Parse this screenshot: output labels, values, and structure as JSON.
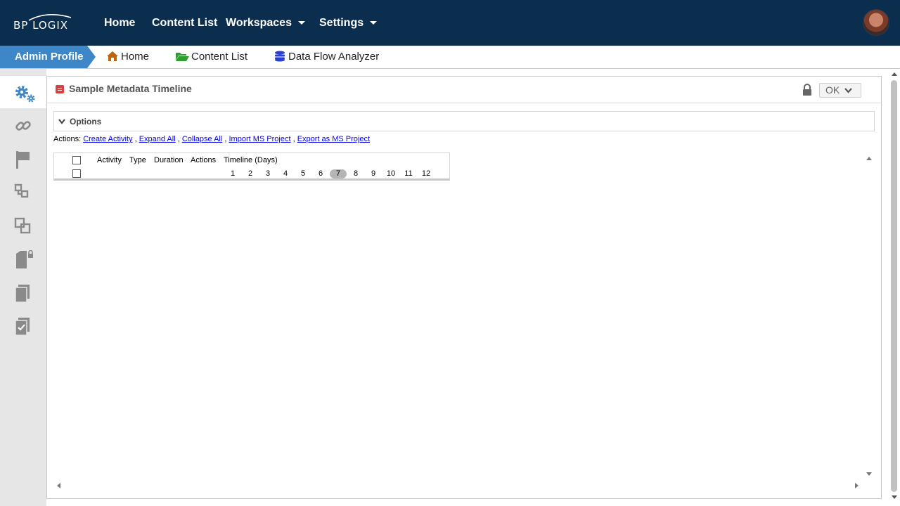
{
  "brand": {
    "logo_text": "BP LOGIX"
  },
  "topnav": {
    "items": [
      {
        "label": "Home",
        "has_dropdown": false
      },
      {
        "label": "Content List",
        "has_dropdown": false
      },
      {
        "label": "Workspaces",
        "has_dropdown": true
      },
      {
        "label": "Settings",
        "has_dropdown": true
      }
    ]
  },
  "breadcrumb": {
    "profile": "Admin Profile",
    "items": [
      {
        "label": "Home",
        "icon": "home-icon",
        "color": "#c0640a"
      },
      {
        "label": "Content List",
        "icon": "folder-open-icon",
        "color": "#2e9e2e"
      },
      {
        "label": "Data Flow Analyzer",
        "icon": "database-icon",
        "color": "#2a3ed0"
      }
    ]
  },
  "sidebar": {
    "items": [
      {
        "icon": "gears-icon",
        "active": true
      },
      {
        "icon": "link-icon",
        "active": false
      },
      {
        "icon": "flag-icon",
        "active": false
      },
      {
        "icon": "workflow-icon",
        "active": false
      },
      {
        "icon": "copy-squares-icon",
        "active": false
      },
      {
        "icon": "locked-document-icon",
        "active": false
      },
      {
        "icon": "documents-icon",
        "active": false
      },
      {
        "icon": "checked-document-icon",
        "active": false
      }
    ]
  },
  "panel": {
    "title": "Sample Metadata Timeline",
    "ok_label": "OK",
    "options_label": "Options",
    "actions_prefix": "Actions:",
    "actions": [
      "Create Activity",
      "Expand All",
      "Collapse All",
      "Import MS Project",
      "Export as MS Project"
    ],
    "table": {
      "headers": [
        "Activity",
        "Type",
        "Duration",
        "Actions",
        "Timeline (Days)"
      ],
      "days": [
        "1",
        "2",
        "3",
        "4",
        "5",
        "6",
        "7",
        "8",
        "9",
        "10",
        "11",
        "12"
      ],
      "highlighted_day": "7"
    }
  },
  "colors": {
    "topbar": "#0b2e4f",
    "profile_tab": "#3d87c8",
    "accent_icon": "#3d87c8",
    "link": "#0000ee"
  }
}
